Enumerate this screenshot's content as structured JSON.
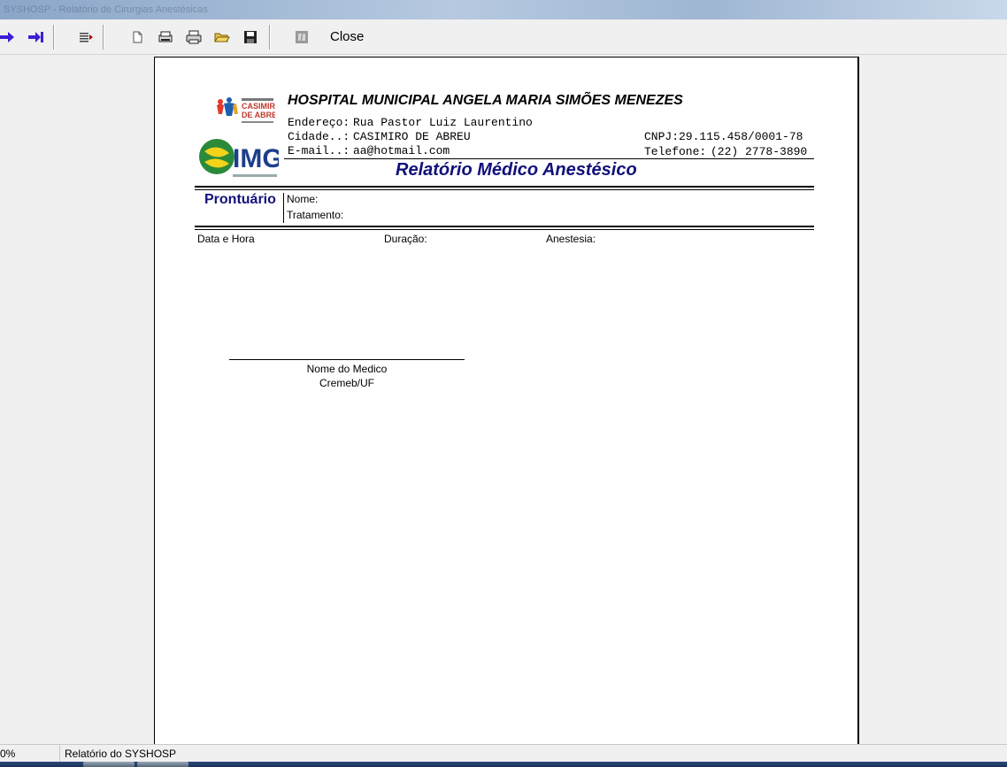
{
  "window": {
    "title": "SYSHOSP - Relatório de Cirurgias Anestésicas"
  },
  "toolbar": {
    "close_label": "Close",
    "buttons": [
      {
        "icon": "next-page-arrow-icon"
      },
      {
        "icon": "last-page-arrow-icon"
      },
      {
        "icon": "page-width-icon"
      },
      {
        "icon": "whole-page-icon"
      },
      {
        "icon": "print-setup-icon"
      },
      {
        "icon": "printer-icon"
      },
      {
        "icon": "open-folder-icon"
      },
      {
        "icon": "save-disk-icon"
      },
      {
        "icon": "disabled-stop-icon"
      }
    ]
  },
  "report": {
    "hospital_name": "HOSPITAL MUNICIPAL ANGELA MARIA SIMÕES MENEZES",
    "address_label": "Endereço:",
    "address_value": "Rua Pastor Luiz Laurentino",
    "city_label": "Cidade..:",
    "city_value": "CASIMIRO DE ABREU",
    "email_label": "E-mail..:",
    "email_value": "aa@hotmail.com",
    "cnpj": "CNPJ:29.115.458/0001-78",
    "phone_label": "Telefone:",
    "phone_value": "(22)  2778-3890",
    "title": "Relatório Médico Anestésico",
    "prontuario_label": "Prontuário",
    "name_label": "Nome:",
    "treatment_label": "Tratamento:",
    "col_datetime": "Data e Hora",
    "col_duration": "Duração:",
    "col_anesthesia": "Anestesia:",
    "doctor_name": "Nome do Medico",
    "doctor_reg": "Cremeb/UF",
    "logo1_text": "CASIMIRO DE ABREU",
    "logo2_text": "IMG"
  },
  "status": {
    "zoom": "0%",
    "message": "Relatório do SYSHOSP"
  },
  "colors": {
    "report_title": "#10107a",
    "arrow": "#3a1fd6"
  }
}
